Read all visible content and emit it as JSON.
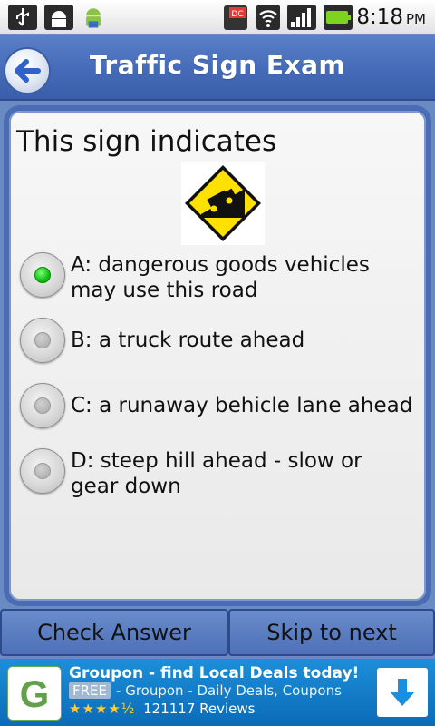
{
  "status_bar": {
    "time": "8:18",
    "ampm": "PM",
    "icons": [
      "usb-icon",
      "android-debug-icon",
      "android-icon",
      "calendar-icon",
      "wifi-icon",
      "signal-icon",
      "battery-icon"
    ]
  },
  "header": {
    "title": "Traffic Sign Exam",
    "back_icon": "back-arrow-icon"
  },
  "question": {
    "text": "This sign indicates",
    "sign_icon": "steep-hill-truck-sign",
    "options": [
      {
        "label": "A: dangerous goods vehicles may use this road",
        "selected": true
      },
      {
        "label": "B: a truck route ahead",
        "selected": false
      },
      {
        "label": "C: a runaway behicle lane ahead",
        "selected": false
      },
      {
        "label": "D: steep hill ahead - slow or gear down",
        "selected": false
      }
    ]
  },
  "actions": {
    "check_label": "Check Answer",
    "skip_label": "Skip to next"
  },
  "ad": {
    "title": "Groupon - find Local Deals today!",
    "free_badge": "FREE",
    "subtitle": "- Groupon - Daily Deals, Coupons",
    "rating_stars": "★★★★½",
    "rating_count": "121117",
    "reviews_label": "Reviews",
    "logo_letter": "G",
    "download_icon": "download-arrow-icon"
  },
  "colors": {
    "header_blue": "#456bb8",
    "panel_border": "#4a6cb5",
    "selected_green": "#10c010",
    "sign_yellow": "#ffe100",
    "ad_blue": "#1d8fd9"
  }
}
